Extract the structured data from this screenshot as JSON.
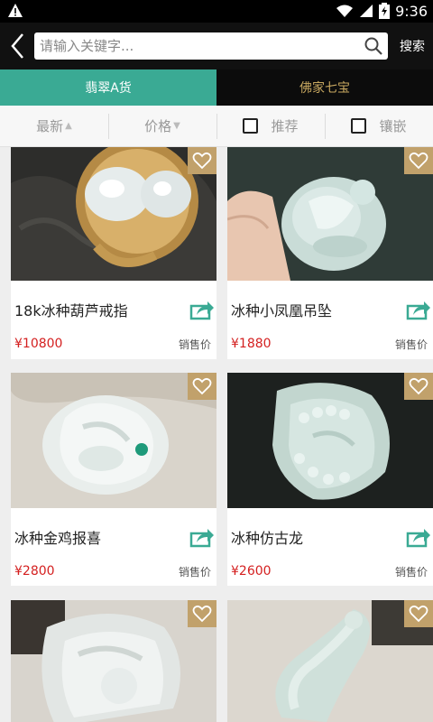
{
  "status": {
    "time": "9:36"
  },
  "search": {
    "placeholder": "请输入关键字...",
    "button": "搜索"
  },
  "tabs": [
    {
      "label": "翡翠A货",
      "active": true
    },
    {
      "label": "佛家七宝",
      "active": false
    }
  ],
  "filters": {
    "newest": "最新",
    "price": "价格",
    "recommend": "推荐",
    "inlay": "镶嵌"
  },
  "products": [
    {
      "title": "18k冰种葫芦戒指",
      "price": "¥10800",
      "price_label": "销售价"
    },
    {
      "title": "冰种小凤凰吊坠",
      "price": "¥1880",
      "price_label": "销售价"
    },
    {
      "title": "冰种金鸡报喜",
      "price": "¥2800",
      "price_label": "销售价"
    },
    {
      "title": "冰种仿古龙",
      "price": "¥2600",
      "price_label": "销售价"
    },
    {
      "title": "",
      "price": "",
      "price_label": ""
    },
    {
      "title": "",
      "price": "",
      "price_label": ""
    }
  ],
  "colors": {
    "accent": "#3aaa94",
    "gold": "#c1a16b",
    "price": "#d42020"
  },
  "icons": {
    "back": "back-arrow-icon",
    "search": "search-icon",
    "favorite": "heart-icon",
    "share": "share-icon"
  }
}
